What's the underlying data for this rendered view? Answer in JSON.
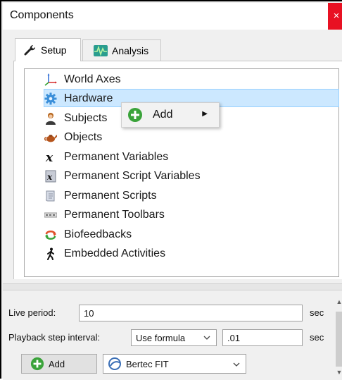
{
  "window": {
    "title": "Components",
    "close_glyph": "×"
  },
  "tabs": [
    {
      "label": "Setup",
      "icon": "wrench-icon",
      "active": true
    },
    {
      "label": "Analysis",
      "icon": "waveform-icon",
      "active": false
    }
  ],
  "tree": {
    "items": [
      {
        "label": "World Axes",
        "icon": "axes-icon"
      },
      {
        "label": "Hardware",
        "icon": "gear-icon",
        "selected": true
      },
      {
        "label": "Subjects",
        "icon": "person-icon"
      },
      {
        "label": "Objects",
        "icon": "teapot-icon"
      },
      {
        "label": "Permanent Variables",
        "icon": "variable-x-icon"
      },
      {
        "label": "Permanent Script Variables",
        "icon": "script-variable-icon"
      },
      {
        "label": "Permanent Scripts",
        "icon": "scroll-icon"
      },
      {
        "label": "Permanent Toolbars",
        "icon": "toolbar-icon"
      },
      {
        "label": "Biofeedbacks",
        "icon": "feedback-loop-icon"
      },
      {
        "label": "Embedded Activities",
        "icon": "walking-figure-icon"
      }
    ]
  },
  "context_menu": {
    "items": [
      {
        "label": "Add",
        "icon": "green-plus-icon",
        "has_submenu": true
      }
    ]
  },
  "settings": {
    "live_period_label": "Live period:",
    "live_period_value": "10",
    "live_period_unit": "sec",
    "playback_label": "Playback step interval:",
    "playback_mode": "Use formula",
    "playback_value": ".01",
    "playback_unit": "sec",
    "add_button_label": "Add",
    "device_select": "Bertec FIT"
  },
  "colors": {
    "selection_bg": "#cce8ff",
    "close_button": "#e81123",
    "add_green": "#3aa33a"
  }
}
